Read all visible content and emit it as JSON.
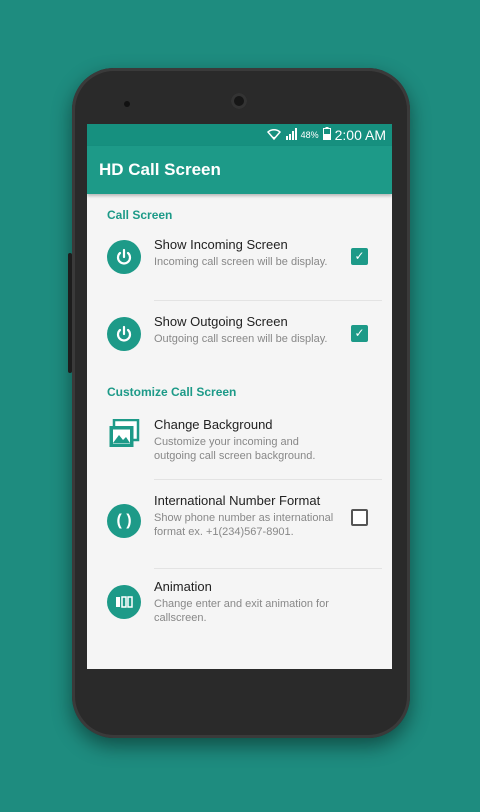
{
  "status_bar": {
    "battery": "48%",
    "time": "2:00 AM"
  },
  "app_bar": {
    "title": "HD Call Screen"
  },
  "sections": [
    {
      "title": "Call Screen",
      "items": [
        {
          "title": "Show Incoming Screen",
          "summary": "Incoming call screen will be display.",
          "checked": true,
          "icon": "power-icon"
        },
        {
          "title": "Show Outgoing Screen",
          "summary": "Outgoing call screen will be display.",
          "checked": true,
          "icon": "power-icon"
        }
      ]
    },
    {
      "title": "Customize Call Screen",
      "items": [
        {
          "title": "Change Background",
          "summary": "Customize your incoming and outgoing call screen background.",
          "icon": "image-icon"
        },
        {
          "title": "International Number Format",
          "summary": "Show phone number as international format ex. +1(234)567-8901.",
          "checked": false,
          "icon": "parentheses-icon"
        },
        {
          "title": "Animation",
          "summary": "Change enter and exit animation for callscreen.",
          "icon": "animation-icon"
        }
      ]
    }
  ],
  "colors": {
    "accent": "#1d9a88",
    "background": "#1e8c7f"
  }
}
